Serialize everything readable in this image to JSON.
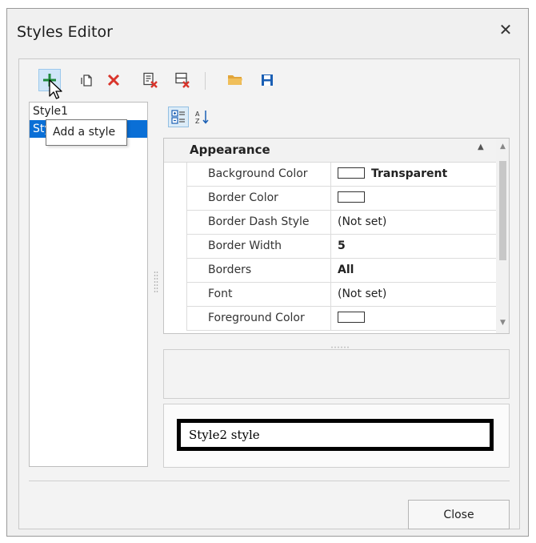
{
  "window": {
    "title": "Styles Editor",
    "close_glyph": "✕"
  },
  "toolbar": {
    "buttons": [
      {
        "name": "add-style-button",
        "icon": "plus-icon",
        "tooltip": "Add a style",
        "color": "#1f8a3b"
      },
      {
        "name": "copy-style-button",
        "icon": "copy-icon"
      },
      {
        "name": "delete-style-button",
        "icon": "delete-x-icon",
        "color": "#d9342b"
      },
      {
        "name": "clear-styles-button",
        "icon": "list-delete-icon"
      },
      {
        "name": "purge-styles-button",
        "icon": "list-purge-icon"
      },
      {
        "name": "open-file-button",
        "icon": "folder-open-icon",
        "color": "#e2a53a"
      },
      {
        "name": "save-file-button",
        "icon": "save-icon",
        "color": "#1a5fb4"
      }
    ]
  },
  "style_list": {
    "items": [
      "Style1",
      "Style2"
    ],
    "selected": "Style2"
  },
  "tooltip": {
    "text": "Add a style"
  },
  "properties": {
    "category": "Appearance",
    "rows": [
      {
        "name": "Background Color",
        "value": "Transparent",
        "swatch": true,
        "bold": true
      },
      {
        "name": "Border Color",
        "value": "",
        "swatch": true,
        "bold": false
      },
      {
        "name": "Border Dash Style",
        "value": "(Not set)",
        "swatch": false,
        "bold": false
      },
      {
        "name": "Border Width",
        "value": "5",
        "swatch": false,
        "bold": true
      },
      {
        "name": "Borders",
        "value": "All",
        "swatch": false,
        "bold": true
      },
      {
        "name": "Font",
        "value": "(Not set)",
        "swatch": false,
        "bold": false
      },
      {
        "name": "Foreground Color",
        "value": "",
        "swatch": true,
        "bold": false
      }
    ]
  },
  "preview": {
    "text": "Style2 style"
  },
  "footer": {
    "close_label": "Close"
  },
  "colors": {
    "selection": "#0a6fd6",
    "hover": "#cfe6f8"
  }
}
